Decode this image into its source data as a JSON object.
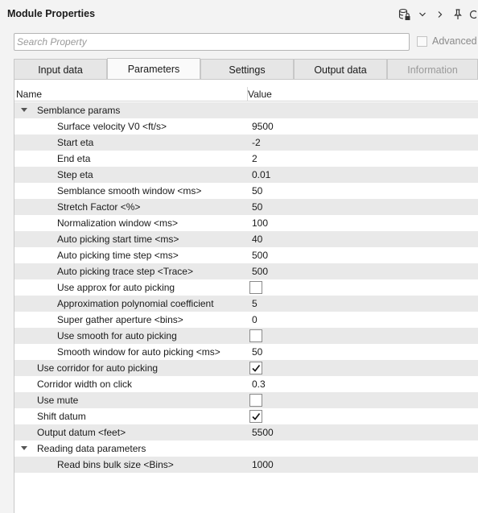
{
  "window": {
    "title": "Module Properties",
    "icons": [
      "database-lock-icon",
      "chevron-down-icon",
      "chevron-right-icon",
      "pin-icon",
      "more-icon"
    ]
  },
  "search": {
    "placeholder": "Search Property",
    "value": ""
  },
  "advanced": {
    "label": "Advanced",
    "checked": false
  },
  "tabs": [
    {
      "label": "Input data",
      "active": false,
      "disabled": false
    },
    {
      "label": "Parameters",
      "active": true,
      "disabled": false
    },
    {
      "label": "Settings",
      "active": false,
      "disabled": false
    },
    {
      "label": "Output data",
      "active": false,
      "disabled": false
    },
    {
      "label": "Information",
      "active": false,
      "disabled": true
    }
  ],
  "grid": {
    "headers": {
      "name": "Name",
      "value": "Value"
    },
    "rows": [
      {
        "type": "group",
        "level": 0,
        "name": "Semblance params",
        "expanded": true
      },
      {
        "type": "text",
        "level": 1,
        "name": "Surface velocity V0 <ft/s>",
        "value": "9500"
      },
      {
        "type": "text",
        "level": 1,
        "name": "Start eta",
        "value": "-2"
      },
      {
        "type": "text",
        "level": 1,
        "name": "End eta",
        "value": "2"
      },
      {
        "type": "text",
        "level": 1,
        "name": "Step eta",
        "value": "0.01"
      },
      {
        "type": "text",
        "level": 1,
        "name": "Semblance smooth window <ms>",
        "value": "50"
      },
      {
        "type": "text",
        "level": 1,
        "name": "Stretch Factor <%>",
        "value": "50"
      },
      {
        "type": "text",
        "level": 1,
        "name": "Normalization window <ms>",
        "value": "100"
      },
      {
        "type": "text",
        "level": 1,
        "name": "Auto picking start time <ms>",
        "value": "40"
      },
      {
        "type": "text",
        "level": 1,
        "name": "Auto picking time step <ms>",
        "value": "500"
      },
      {
        "type": "text",
        "level": 1,
        "name": "Auto picking trace step <Trace>",
        "value": "500"
      },
      {
        "type": "check",
        "level": 1,
        "name": "Use approx for auto picking",
        "checked": false
      },
      {
        "type": "text",
        "level": 1,
        "name": "Approximation polynomial coefficient",
        "value": "5"
      },
      {
        "type": "text",
        "level": 1,
        "name": "Super gather aperture <bins>",
        "value": "0"
      },
      {
        "type": "check",
        "level": 1,
        "name": "Use smooth for auto picking",
        "checked": false
      },
      {
        "type": "text",
        "level": 1,
        "name": "Smooth window for auto picking <ms>",
        "value": "50"
      },
      {
        "type": "check",
        "level": 0,
        "name": "Use corridor for auto picking",
        "checked": true
      },
      {
        "type": "text",
        "level": 0,
        "name": "Corridor width on click",
        "value": "0.3"
      },
      {
        "type": "check",
        "level": 0,
        "name": "Use mute",
        "checked": false
      },
      {
        "type": "check",
        "level": 0,
        "name": "Shift datum",
        "checked": true
      },
      {
        "type": "text",
        "level": 0,
        "name": "Output datum <feet>",
        "value": "5500"
      },
      {
        "type": "group",
        "level": 0,
        "name": "Reading data parameters",
        "expanded": true
      },
      {
        "type": "text",
        "level": 1,
        "name": "Read bins bulk size <Bins>",
        "value": "1000"
      }
    ]
  }
}
